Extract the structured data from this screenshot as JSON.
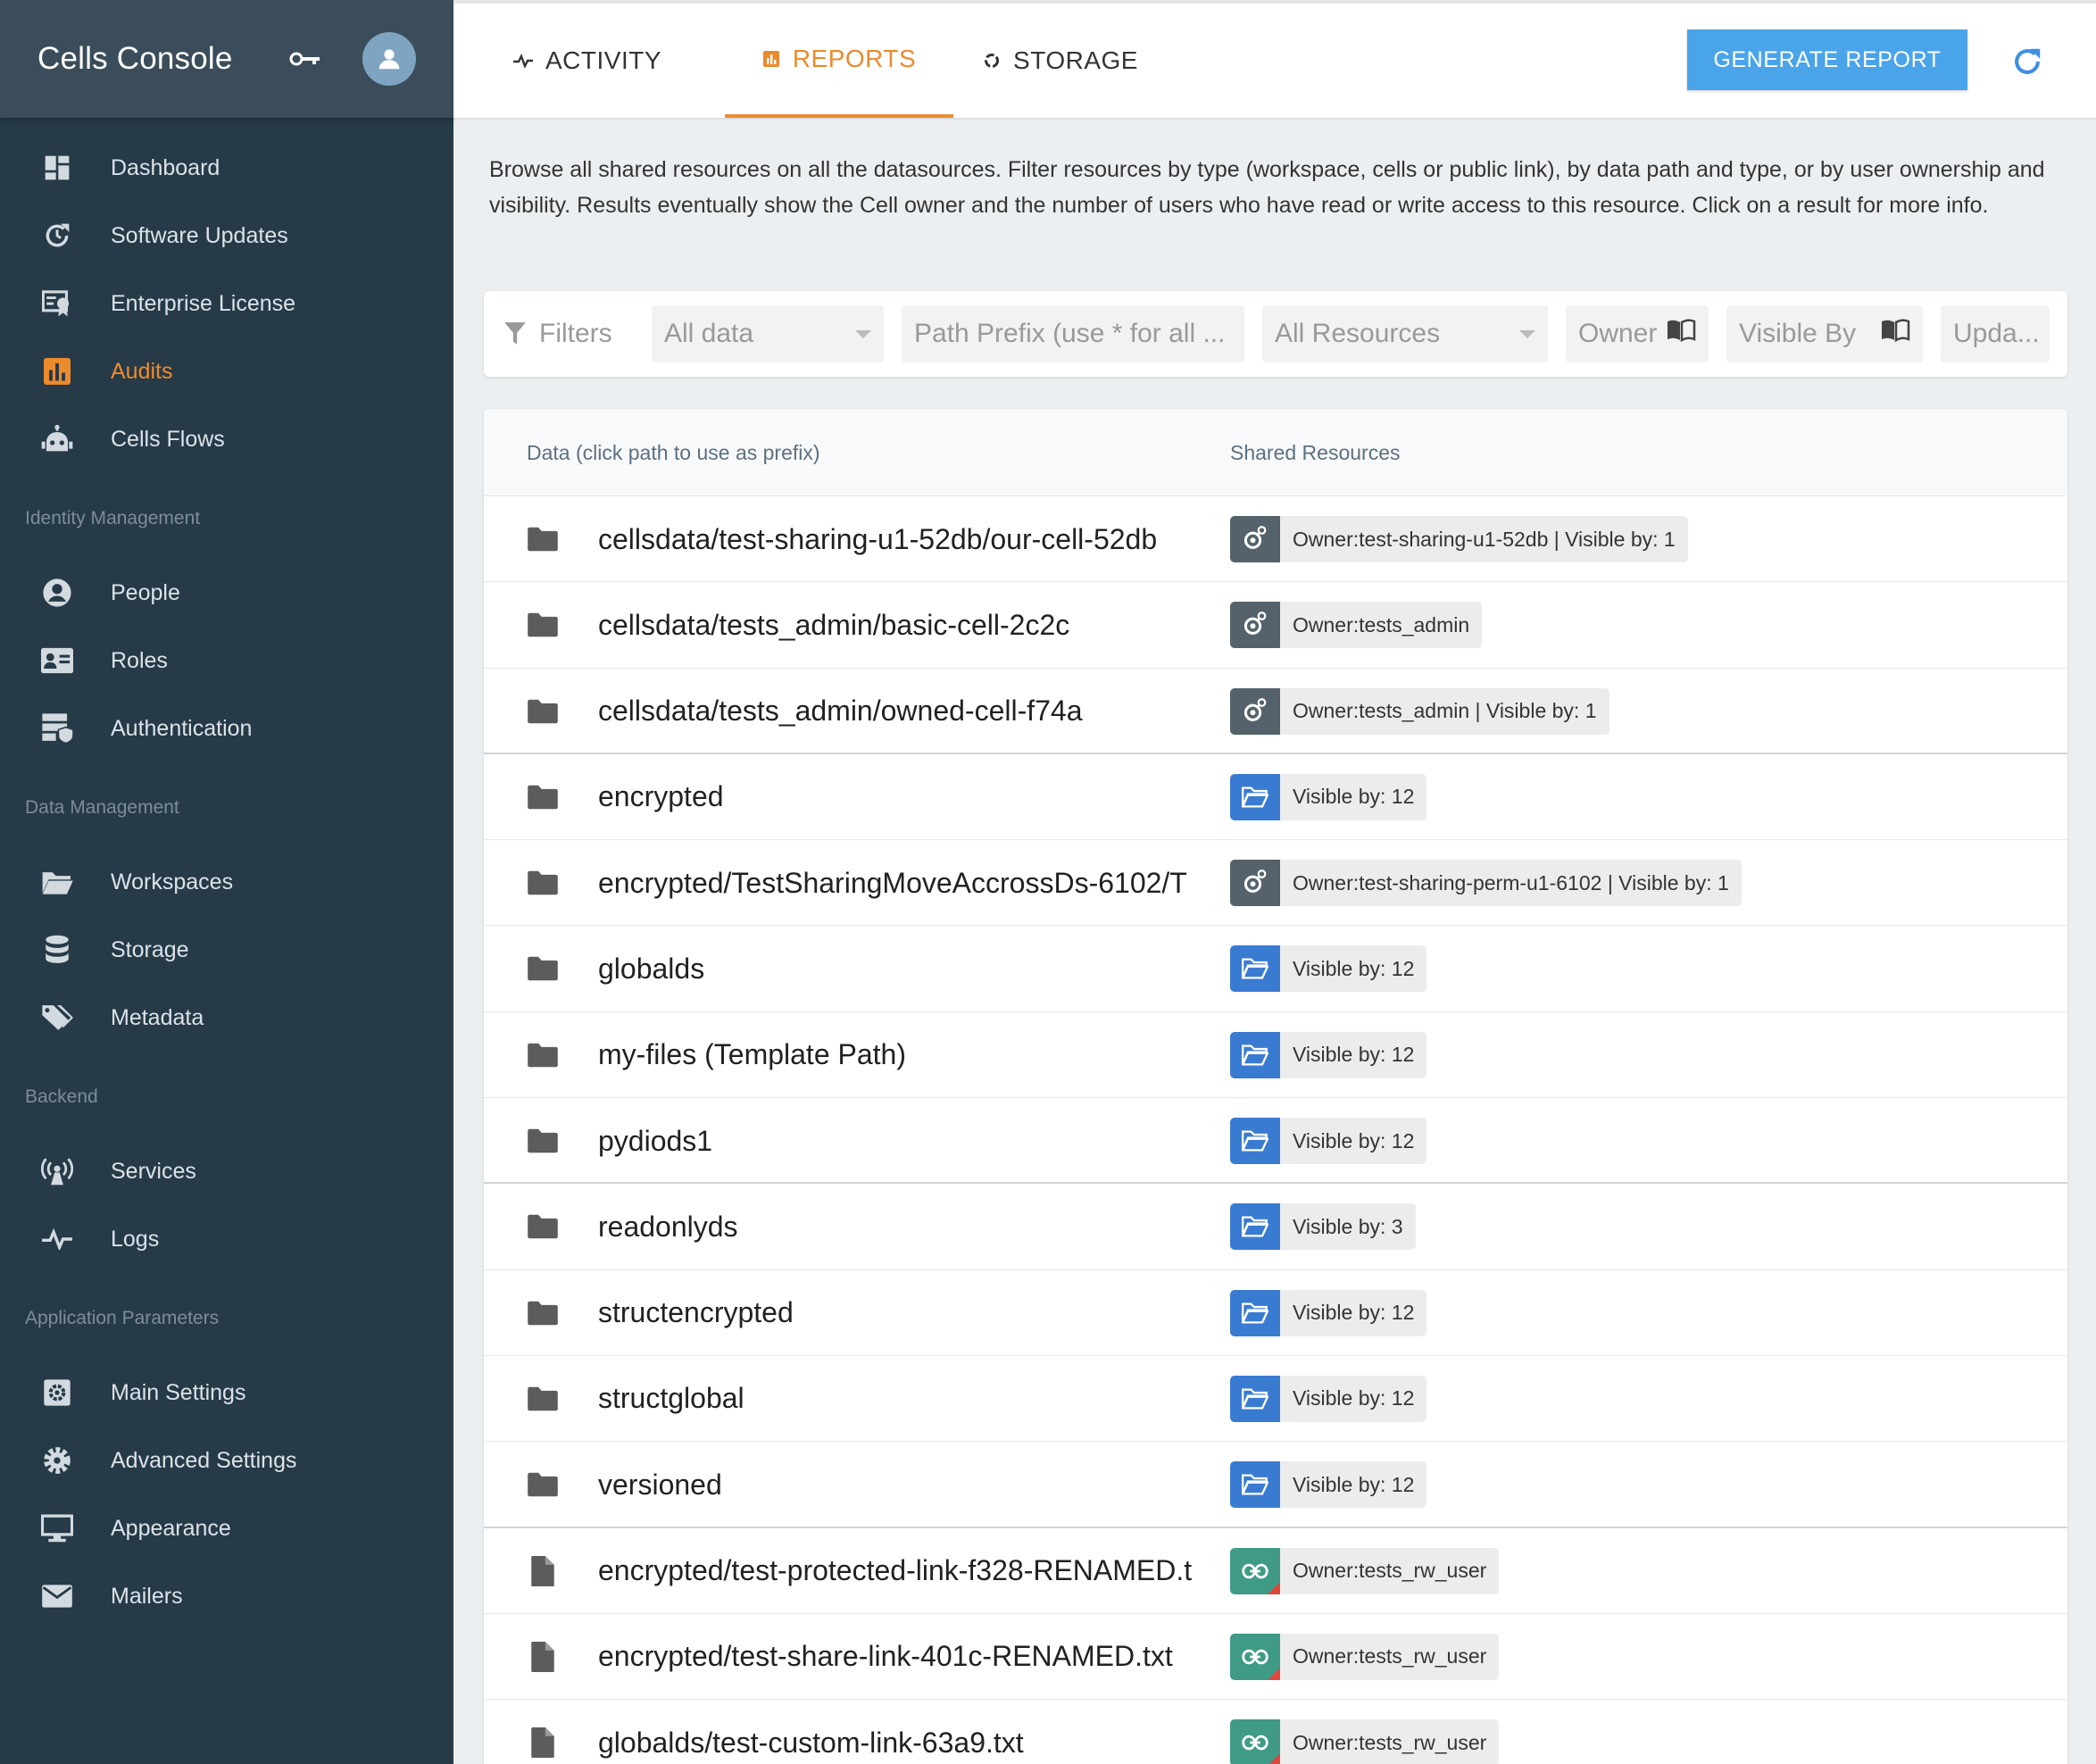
{
  "app": {
    "title": "Cells Console"
  },
  "sidebar": {
    "groups": [
      {
        "section": "",
        "items": [
          {
            "label": "Dashboard",
            "icon": "dashboard-icon"
          },
          {
            "label": "Software Updates",
            "icon": "update-icon"
          },
          {
            "label": "Enterprise License",
            "icon": "certificate-icon"
          },
          {
            "label": "Audits",
            "icon": "chart-icon",
            "active": true
          },
          {
            "label": "Cells Flows",
            "icon": "robot-icon"
          }
        ]
      },
      {
        "section": "Identity Management",
        "items": [
          {
            "label": "People",
            "icon": "person-icon"
          },
          {
            "label": "Roles",
            "icon": "id-card-icon"
          },
          {
            "label": "Authentication",
            "icon": "server-shield-icon"
          }
        ]
      },
      {
        "section": "Data Management",
        "items": [
          {
            "label": "Workspaces",
            "icon": "folder-open-icon"
          },
          {
            "label": "Storage",
            "icon": "database-icon"
          },
          {
            "label": "Metadata",
            "icon": "tags-icon"
          }
        ]
      },
      {
        "section": "Backend",
        "items": [
          {
            "label": "Services",
            "icon": "antenna-icon"
          },
          {
            "label": "Logs",
            "icon": "pulse-icon"
          }
        ]
      },
      {
        "section": "Application Parameters",
        "items": [
          {
            "label": "Main Settings",
            "icon": "settings-box-icon"
          },
          {
            "label": "Advanced Settings",
            "icon": "gear-icon"
          },
          {
            "label": "Appearance",
            "icon": "monitor-icon"
          },
          {
            "label": "Mailers",
            "icon": "mail-icon"
          }
        ]
      }
    ]
  },
  "tabs": {
    "activity": "ACTIVITY",
    "reports": "REPORTS",
    "storage": "STORAGE"
  },
  "toolbar": {
    "generate": "GENERATE REPORT"
  },
  "description": "Browse all shared resources on all the datasources. Filter resources by type (workspace, cells or public link), by data path and type, or by user ownership and visibility. Results eventually show the Cell owner and the number of users who have read or write access to this resource. Click on a result for more info.",
  "filters": {
    "label": "Filters",
    "data_select": "All data",
    "path_placeholder": "Path Prefix (use * for all ...",
    "resources_select": "All Resources",
    "owner": "Owner",
    "visible_by": "Visible By",
    "updated": "Upda..."
  },
  "table": {
    "headers": {
      "data": "Data (click path to use as prefix)",
      "resources": "Shared Resources"
    },
    "rows": [
      {
        "kind": "folder",
        "path": "cellsdata/test-sharing-u1-52db/our-cell-52db",
        "type": "cell",
        "resource": "Owner:test-sharing-u1-52db | Visible by: 1"
      },
      {
        "kind": "folder",
        "path": "cellsdata/tests_admin/basic-cell-2c2c",
        "type": "cell",
        "resource": "Owner:tests_admin"
      },
      {
        "kind": "folder",
        "path": "cellsdata/tests_admin/owned-cell-f74a",
        "type": "cell",
        "resource": "Owner:tests_admin | Visible by: 1"
      },
      {
        "kind": "folder",
        "path": "encrypted",
        "type": "workspace",
        "resource": "Visible by: 12"
      },
      {
        "kind": "folder",
        "path": "encrypted/TestSharingMoveAccrossDs-6102/T",
        "type": "cell",
        "resource": "Owner:test-sharing-perm-u1-6102 | Visible by: 1"
      },
      {
        "kind": "folder",
        "path": "globalds",
        "type": "workspace",
        "resource": "Visible by: 12"
      },
      {
        "kind": "folder",
        "path": "my-files (Template Path)",
        "type": "workspace",
        "resource": "Visible by: 12"
      },
      {
        "kind": "folder",
        "path": "pydiods1",
        "type": "workspace",
        "resource": "Visible by: 12"
      },
      {
        "kind": "folder",
        "path": "readonlyds",
        "type": "workspace",
        "resource": "Visible by: 3"
      },
      {
        "kind": "folder",
        "path": "structencrypted",
        "type": "workspace",
        "resource": "Visible by: 12"
      },
      {
        "kind": "folder",
        "path": "structglobal",
        "type": "workspace",
        "resource": "Visible by: 12"
      },
      {
        "kind": "folder",
        "path": "versioned",
        "type": "workspace",
        "resource": "Visible by: 12"
      },
      {
        "kind": "file",
        "path": "encrypted/test-protected-link-f328-RENAMED.t",
        "type": "link",
        "resource": "Owner:tests_rw_user"
      },
      {
        "kind": "file",
        "path": "encrypted/test-share-link-401c-RENAMED.txt",
        "type": "link",
        "resource": "Owner:tests_rw_user"
      },
      {
        "kind": "file",
        "path": "globalds/test-custom-link-63a9.txt",
        "type": "link",
        "resource": "Owner:tests_rw_user"
      }
    ]
  },
  "colors": {
    "sidebar_bg": "#263a48",
    "accent": "#ec8a2e",
    "primary_button": "#4aa4ea",
    "cell_chip": "#55626c",
    "workspace_chip": "#3a7bd2",
    "link_chip": "#3f9b86"
  }
}
